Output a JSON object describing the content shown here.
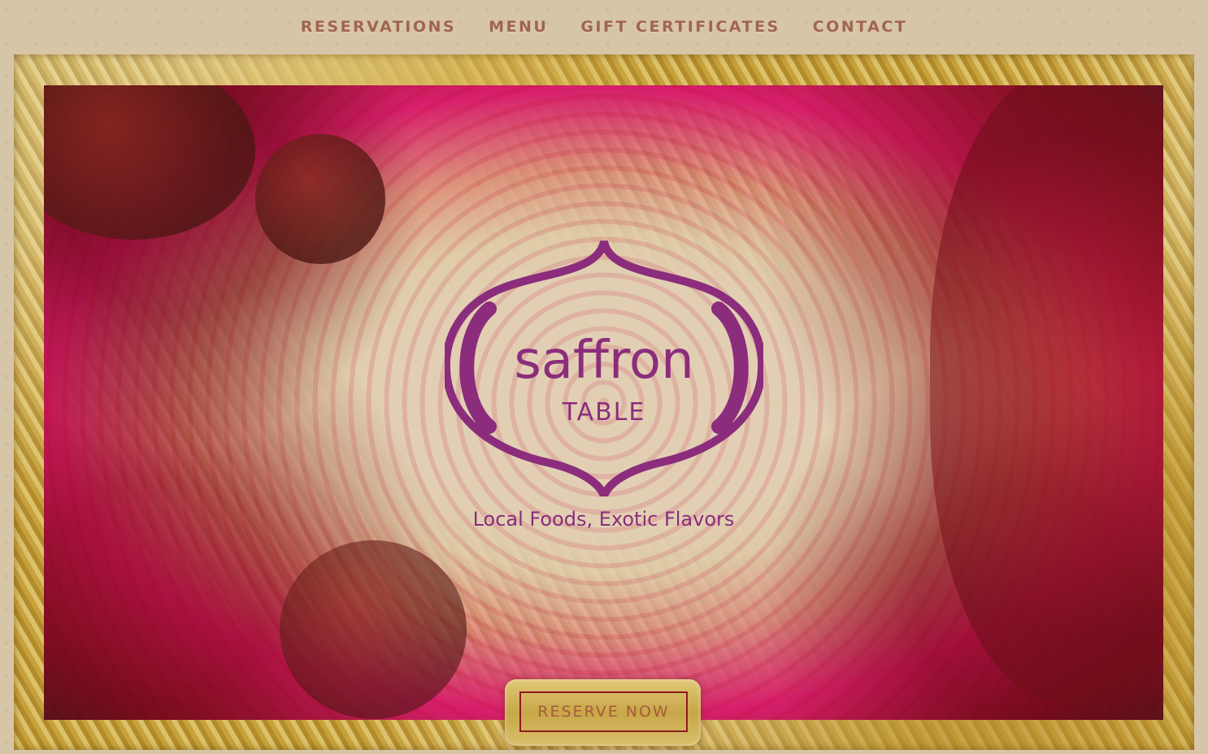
{
  "nav": {
    "items": [
      {
        "label": "RESERVATIONS"
      },
      {
        "label": "MENU"
      },
      {
        "label": "GIFT CERTIFICATES"
      },
      {
        "label": "CONTACT"
      }
    ]
  },
  "hero": {
    "logo_name": "saffron",
    "logo_sub": "TABLE",
    "tagline": "Local Foods, Exotic Flavors",
    "cta_label": "RESERVE NOW"
  },
  "colors": {
    "nav_text": "#a0654f",
    "logo_purple": "#8b2d7c",
    "gold": "#c8a43d",
    "cta_border": "#8e1a1f"
  },
  "icons": [
    "logo-onion-dome-icon"
  ]
}
